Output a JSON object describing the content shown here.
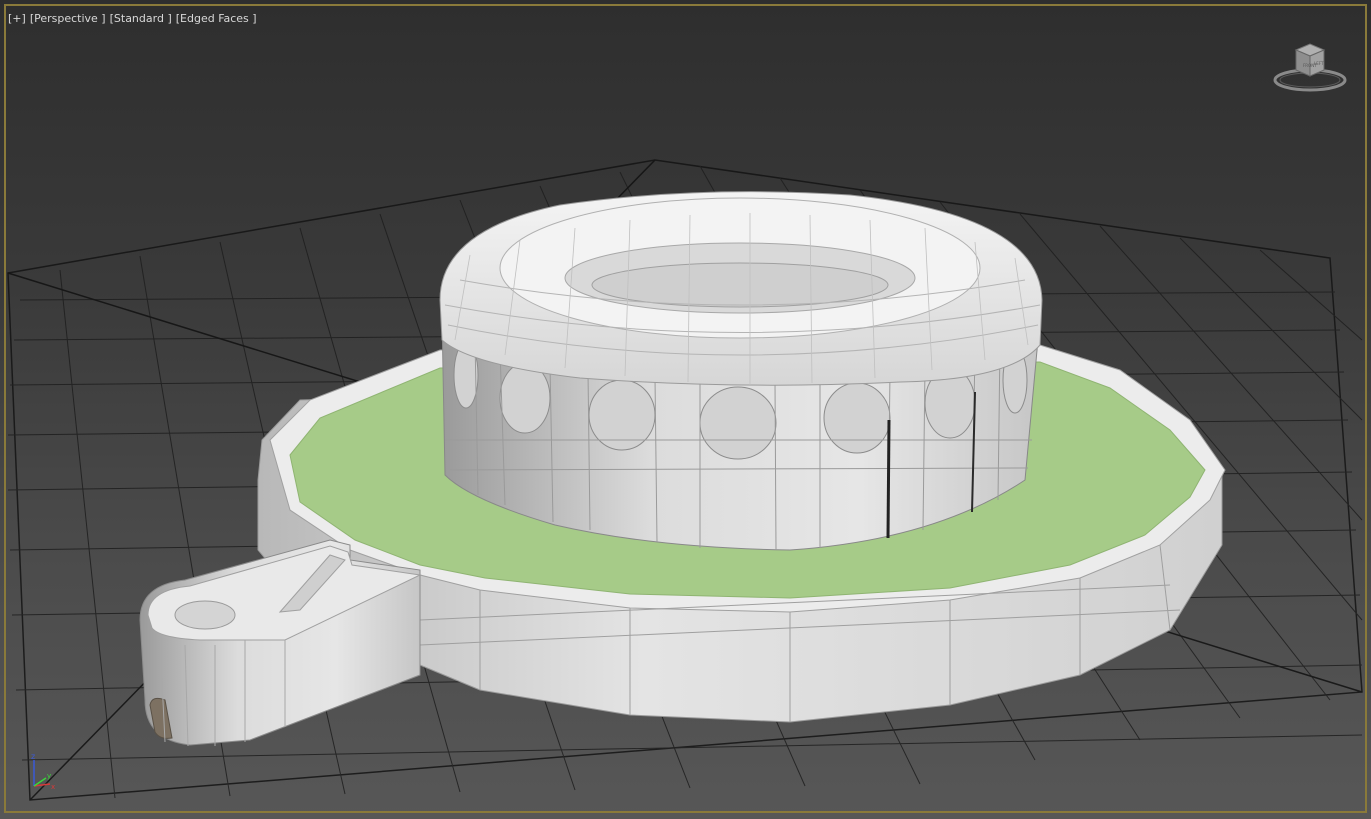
{
  "viewport": {
    "labels": [
      "[+]",
      "[Perspective ]",
      "[Standard ]",
      "[Edged Faces ]"
    ],
    "border_color": "#8a7a3a"
  },
  "viewcube": {
    "front_label": "FRONT",
    "left_label": "LEFT"
  },
  "axis": {
    "x": "x",
    "y": "y",
    "z": "z"
  },
  "colors": {
    "grass": "#a6cb88",
    "model": "#e2e2e2",
    "grid": "#1a1a1a"
  }
}
